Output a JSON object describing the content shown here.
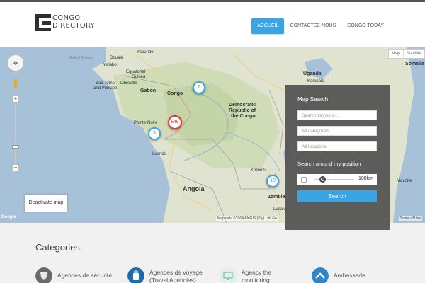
{
  "logo": {
    "line1": "CONGO",
    "line2": "DIRECTORY"
  },
  "nav": {
    "items": [
      {
        "label": "ACCUEIL",
        "active": true
      },
      {
        "label": "CONTACTEZ-NOUS",
        "active": false
      },
      {
        "label": "CONGO TODAY",
        "active": false
      }
    ]
  },
  "map": {
    "type_map": "Map",
    "type_satellite": "Satellite",
    "labels": {
      "gulf": "Gulf of Guinea",
      "yaounde": "Yaounde",
      "douala": "Douala",
      "malabo": "Malabo",
      "equatorial_guinea": "Equatorial",
      "equatorial_guinea2": "Guinea",
      "sao_tome": "Sao Tome",
      "principe": "and Principe",
      "libreville": "Libreville",
      "gabon": "Gabon",
      "congo": "Congo",
      "pointe_noire": "Pointe-Noire",
      "luanda": "Luanda",
      "drc1": "Democratic",
      "drc2": "Republic of",
      "drc3": "the Congo",
      "uganda": "Uganda",
      "kampala": "Kampala",
      "somalia": "Somalia",
      "angola": "Angola",
      "kolwezi": "Kolwezi",
      "zambia": "Zambia",
      "lusaka": "Lusaka",
      "mayotte": "Mayotte"
    },
    "clusters": [
      {
        "count": "2",
        "color": "#3ba5e3"
      },
      {
        "count": "545",
        "color": "#e0393e"
      },
      {
        "count": "3",
        "color": "#3ba5e3"
      },
      {
        "count": "18",
        "color": "#3ba5e3"
      }
    ],
    "deactivate_label": "Deactivate map",
    "attribution": "Map data ©2014 AfriGIS (Pty) Ltd, Go",
    "terms": "Terms of Use",
    "google": "Google"
  },
  "search": {
    "title": "Map Search",
    "keyword_placeholder": "Search keyword...",
    "categories_value": "All categories",
    "locations_value": "All locations",
    "around_label": "Search around my position",
    "radius_value": "100km",
    "radius_fraction": 0.2,
    "button_label": "Search"
  },
  "categories": {
    "title": "Categories",
    "items": [
      {
        "line1": "Agences de sécurité",
        "line2": "",
        "icon": "shield-icon",
        "color": "#6a6a6a"
      },
      {
        "line1": "Agences de voyage",
        "line2": "(Travel Agencies)",
        "icon": "luggage-icon",
        "color": "#1f6aa8"
      },
      {
        "line1": "Agency the",
        "line2": "monitoring",
        "icon": "monitor-icon",
        "color": "#9ac9c0"
      },
      {
        "line1": "Ambassade",
        "line2": "",
        "icon": "chevron-icon",
        "color": "#2f85c5"
      }
    ]
  }
}
